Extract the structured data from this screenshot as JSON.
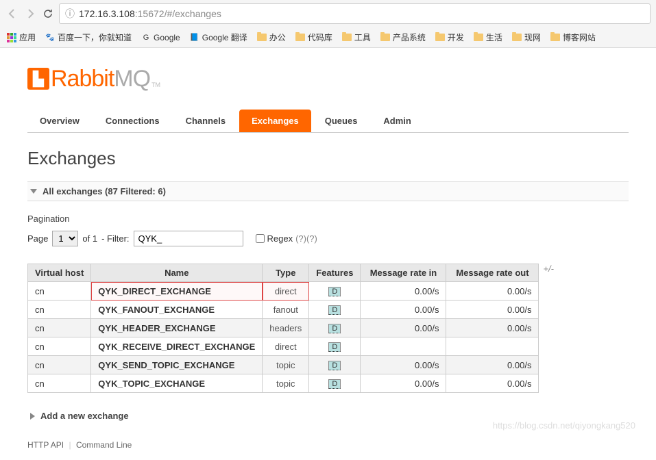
{
  "browser": {
    "url_host": "172.16.3.108",
    "url_port": ":15672",
    "url_path": "/#/exchanges"
  },
  "bookmarks": {
    "apps": "应用",
    "items": [
      {
        "label": "百度一下，你就知道",
        "icon": "🐾"
      },
      {
        "label": "Google",
        "icon": "G"
      },
      {
        "label": "Google 翻译",
        "icon": "📘"
      },
      {
        "label": "办公",
        "folder": true
      },
      {
        "label": "代码库",
        "folder": true
      },
      {
        "label": "工具",
        "folder": true
      },
      {
        "label": "产品系统",
        "folder": true
      },
      {
        "label": "开发",
        "folder": true
      },
      {
        "label": "生活",
        "folder": true
      },
      {
        "label": "现网",
        "folder": true
      },
      {
        "label": "博客网站",
        "folder": true
      }
    ]
  },
  "logo": {
    "rabbit": "Rabbit",
    "mq": "MQ",
    "tm": "TM"
  },
  "tabs": [
    {
      "label": "Overview",
      "active": false
    },
    {
      "label": "Connections",
      "active": false
    },
    {
      "label": "Channels",
      "active": false
    },
    {
      "label": "Exchanges",
      "active": true
    },
    {
      "label": "Queues",
      "active": false
    },
    {
      "label": "Admin",
      "active": false
    }
  ],
  "page_title": "Exchanges",
  "section_all": "All exchanges (87 Filtered: 6)",
  "pagination": {
    "label": "Pagination",
    "page_label": "Page",
    "page_value": "1",
    "of_label": "of 1",
    "filter_label": "- Filter:",
    "filter_value": "QYK_",
    "regex_label": "Regex",
    "help": "(?)(?)"
  },
  "table": {
    "headers": {
      "vhost": "Virtual host",
      "name": "Name",
      "type": "Type",
      "features": "Features",
      "rate_in": "Message rate in",
      "rate_out": "Message rate out"
    },
    "feat_badge": "D",
    "plusminus": "+/-",
    "rows": [
      {
        "vhost": "cn",
        "name": "QYK_DIRECT_EXCHANGE",
        "type": "direct",
        "rate_in": "0.00/s",
        "rate_out": "0.00/s",
        "hl": true
      },
      {
        "vhost": "cn",
        "name": "QYK_FANOUT_EXCHANGE",
        "type": "fanout",
        "rate_in": "0.00/s",
        "rate_out": "0.00/s"
      },
      {
        "vhost": "cn",
        "name": "QYK_HEADER_EXCHANGE",
        "type": "headers",
        "rate_in": "0.00/s",
        "rate_out": "0.00/s"
      },
      {
        "vhost": "cn",
        "name": "QYK_RECEIVE_DIRECT_EXCHANGE",
        "type": "direct",
        "rate_in": "",
        "rate_out": ""
      },
      {
        "vhost": "cn",
        "name": "QYK_SEND_TOPIC_EXCHANGE",
        "type": "topic",
        "rate_in": "0.00/s",
        "rate_out": "0.00/s"
      },
      {
        "vhost": "cn",
        "name": "QYK_TOPIC_EXCHANGE",
        "type": "topic",
        "rate_in": "0.00/s",
        "rate_out": "0.00/s"
      }
    ]
  },
  "section_add": "Add a new exchange",
  "footer": {
    "http_api": "HTTP API",
    "cli": "Command Line"
  },
  "watermark": "https://blog.csdn.net/qiyongkang520"
}
